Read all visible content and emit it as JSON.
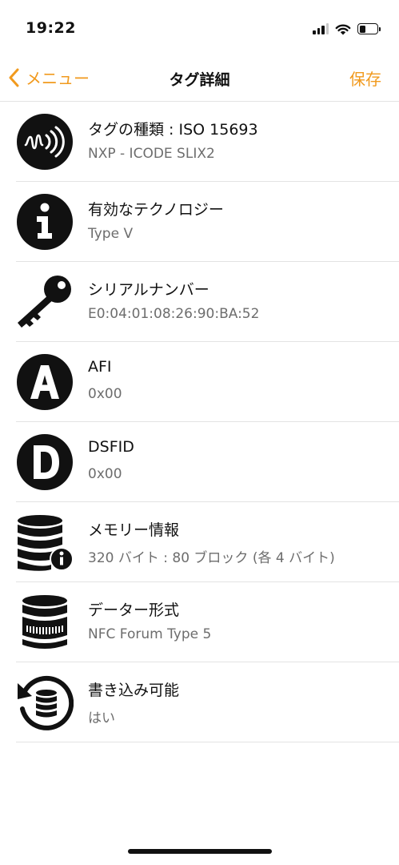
{
  "status": {
    "time": "19:22"
  },
  "nav": {
    "back_label": "メニュー",
    "title": "タグ詳細",
    "save_label": "保存"
  },
  "colors": {
    "accent": "#f19a1e",
    "icon": "#111111"
  },
  "rows": [
    {
      "icon": "nfc-icon",
      "title": "タグの種類 : ISO 15693",
      "value": "NXP - ICODE SLIX2"
    },
    {
      "icon": "info-icon",
      "title": "有効なテクノロジー",
      "value": "Type V"
    },
    {
      "icon": "key-icon",
      "title": "シリアルナンバー",
      "value": "E0:04:01:08:26:90:BA:52"
    },
    {
      "icon": "letter-a-icon",
      "title": "AFI",
      "value": "0x00"
    },
    {
      "icon": "letter-d-icon",
      "title": "DSFID",
      "value": "0x00"
    },
    {
      "icon": "database-info-icon",
      "title": "メモリー情報",
      "value": "320 バイト : 80 ブロック (各 4 バイト)"
    },
    {
      "icon": "data-format-icon",
      "title": "データー形式",
      "value": "NFC Forum Type 5"
    },
    {
      "icon": "database-refresh-icon",
      "title": "書き込み可能",
      "value": "はい"
    }
  ]
}
